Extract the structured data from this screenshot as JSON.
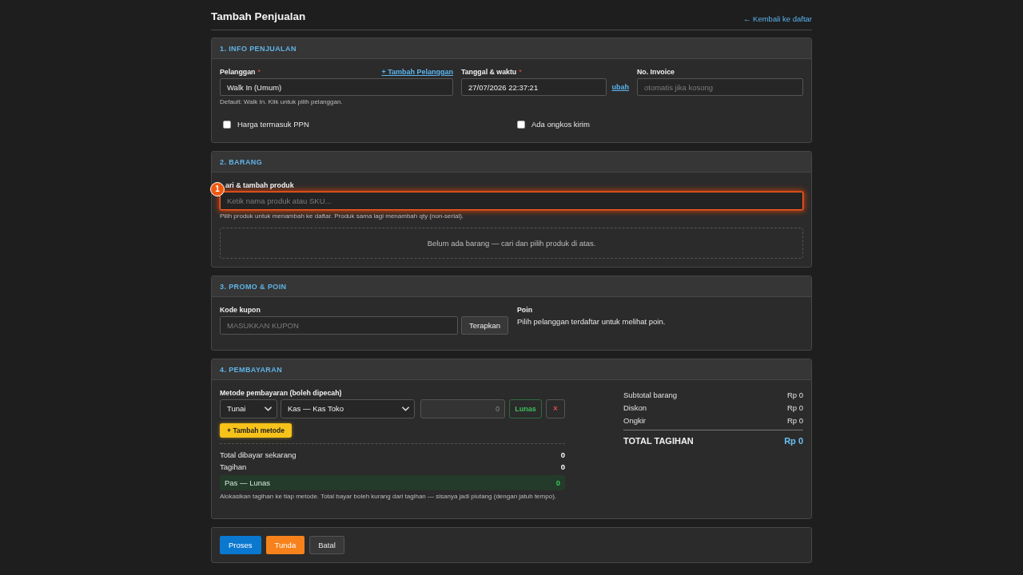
{
  "page": {
    "title": "Tambah Penjualan",
    "back_link": "← Kembali ke daftar"
  },
  "info": {
    "title": "1. INFO PENJUALAN",
    "customer": {
      "label": "Pelanggan",
      "required_mark": "*",
      "add_link": "+ Tambah Pelanggan",
      "value": "Walk In (Umum)",
      "help": "Default: Walk In. Klik untuk pilih pelanggan."
    },
    "datetime": {
      "label": "Tanggal & waktu",
      "required_mark": "*",
      "value": "27/07/2026 22:37:21",
      "edit_link": "ubah"
    },
    "invoice": {
      "label": "No. Invoice",
      "placeholder": "otomatis jika kosong"
    },
    "options": [
      {
        "label": "Harga termasuk PPN",
        "checked": false
      },
      {
        "label": "Ada ongkos kirim",
        "checked": false
      }
    ]
  },
  "barang": {
    "title": "2. BARANG",
    "product_search": {
      "label": "ari & tambah produk",
      "placeholder": "Ketik nama produk atau SKU...",
      "help": "Pilih produk untuk menambah ke daftar. Produk sama lagi menambah qty (non-serial).",
      "highlighted": true,
      "annotation": "1"
    },
    "empty_message": "Belum ada barang — cari dan pilih produk di atas."
  },
  "promo": {
    "title": "3. PROMO & POIN",
    "coupon": {
      "label": "Kode kupon",
      "placeholder": "MASUKKAN KUPON",
      "button": "Terapkan"
    },
    "points": {
      "label": "Poin",
      "text": "Pilih pelanggan terdaftar untuk melihat poin."
    }
  },
  "pembayaran": {
    "title": "4. PEMBAYARAN",
    "methods_label": "Metode pembayaran (boleh dipecah)",
    "methods": [
      {
        "type": "Tunai",
        "account": "Kas — Kas Toko",
        "amount_placeholder": "0",
        "status_button": "Lunas",
        "remove_button": "×"
      }
    ],
    "add_button": "+ Tambah metode",
    "totals": [
      {
        "label": "Total dibayar sekarang",
        "value": "0"
      },
      {
        "label": "Tagihan",
        "value": "0"
      }
    ],
    "balance": {
      "label": "Pas — Lunas",
      "value": "0"
    },
    "help": "Alokasikan tagihan ke tiap metode. Total bayar boleh kurang dari tagihan — sisanya jadi piutang (dengan jatuh tempo).",
    "summary": [
      {
        "label": "Subtotal barang",
        "value": "Rp 0"
      },
      {
        "label": "Diskon",
        "value": "Rp 0"
      },
      {
        "label": "Ongkir",
        "value": "Rp 0"
      }
    ],
    "grand_total": {
      "label": "TOTAL TAGIHAN",
      "value": "Rp 0"
    }
  },
  "actions": [
    {
      "label": "Proses",
      "kind": "primary"
    },
    {
      "label": "Tunda",
      "kind": "warning"
    },
    {
      "label": "Batal",
      "kind": "secondary"
    }
  ]
}
